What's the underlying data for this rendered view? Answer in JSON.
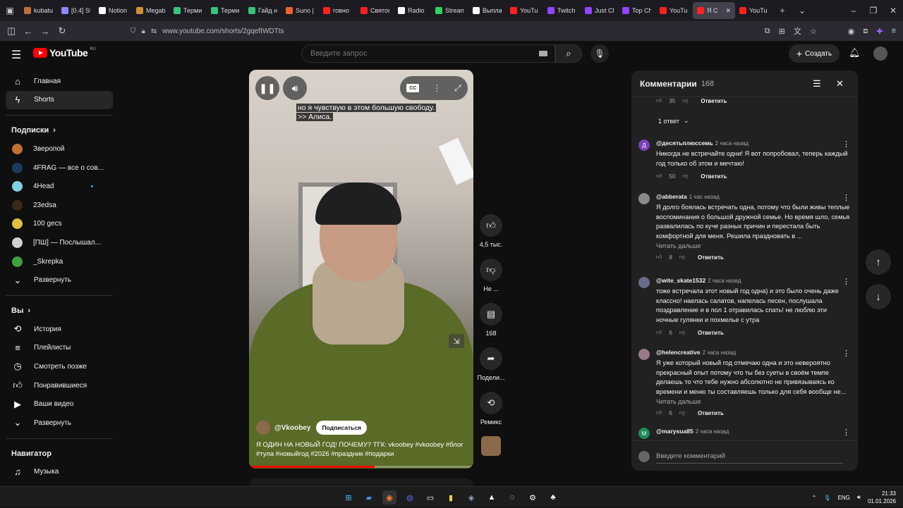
{
  "browser": {
    "tabs": [
      {
        "title": "kubatu",
        "color": "#c0703a"
      },
      {
        "title": "[0.4] St",
        "color": "#8888ff"
      },
      {
        "title": "Notion",
        "color": "#ffffff"
      },
      {
        "title": "Megab",
        "color": "#d09030"
      },
      {
        "title": "Терми",
        "color": "#3ac27a"
      },
      {
        "title": "Терми",
        "color": "#3ac27a"
      },
      {
        "title": "Гайд н",
        "color": "#3ac27a"
      },
      {
        "title": "Suno |",
        "color": "#f06030"
      },
      {
        "title": "говно",
        "color": "#ff2020"
      },
      {
        "title": "Святог",
        "color": "#ff2020"
      },
      {
        "title": "Radio",
        "color": "#ffffff"
      },
      {
        "title": "Stream",
        "color": "#30d060"
      },
      {
        "title": "Выпла",
        "color": "#ffffff"
      },
      {
        "title": "YouTu",
        "color": "#ff2020"
      },
      {
        "title": "Twitch",
        "color": "#9146ff"
      },
      {
        "title": "Just Ch",
        "color": "#9146ff"
      },
      {
        "title": "Top Ch",
        "color": "#9146ff"
      },
      {
        "title": "YouTu",
        "color": "#ff2020"
      },
      {
        "title": "Я С",
        "color": "#ff2020",
        "active": true
      },
      {
        "title": "YouTu",
        "color": "#ff2020"
      }
    ],
    "url": "www.youtube.com/shorts/2gqefIWDTts"
  },
  "header": {
    "logo_text": "YouTube",
    "logo_region": "RU",
    "search_placeholder": "Введите запрос",
    "create_label": "Создать"
  },
  "sidebar": {
    "main": [
      {
        "label": "Главная",
        "icon": "home-icon"
      },
      {
        "label": "Shorts",
        "icon": "shorts-icon",
        "active": true
      }
    ],
    "subs_heading": "Подписки",
    "subs": [
      {
        "label": "Зверопой",
        "color": "#c07030"
      },
      {
        "label": "4FRAG — все о сов...",
        "color": "#1a3a5a"
      },
      {
        "label": "4Head",
        "color": "#80d0e0",
        "new": true
      },
      {
        "label": "23edsa",
        "color": "#3a2a1a"
      },
      {
        "label": "100 gecs",
        "color": "#e0c040"
      },
      {
        "label": "[ПШ] — Послышал...",
        "color": "#d0d0d0"
      },
      {
        "label": "_Skrepka",
        "color": "#40a040"
      }
    ],
    "expand1": "Развернуть",
    "you_heading": "Вы",
    "you": [
      {
        "label": "История",
        "icon": "history-icon"
      },
      {
        "label": "Плейлисты",
        "icon": "playlists-icon"
      },
      {
        "label": "Смотреть позже",
        "icon": "watch-later-icon"
      },
      {
        "label": "Понравившиеся",
        "icon": "liked-icon"
      },
      {
        "label": "Ваши видео",
        "icon": "your-videos-icon"
      }
    ],
    "expand2": "Развернуть",
    "nav_heading": "Навигатор",
    "music": "Музыка"
  },
  "video": {
    "caption_line1": "но я чувствую в этом большую свободу.",
    "caption_line2": ">> Алиса.",
    "author": "@Vkoobey",
    "subscribe": "Подписаться",
    "title": "Я ОДИН НА НОВЫЙ ГОД! ПОЧЕМУ? ТГК: vkoobey #vkoobey #блог #тула #новыйгод #2026 #праздник #подарки",
    "progress": 0.56
  },
  "rail": {
    "likes": "4,5 тыс.",
    "dislike": "Не ...",
    "comments": "168",
    "share": "Подели...",
    "remix": "Ремикс"
  },
  "comments": {
    "title": "Комментарии",
    "count": "168",
    "top_likes": "35",
    "reply_label": "Ответить",
    "replies_toggle": "1 ответ",
    "items": [
      {
        "avatar": "Д",
        "color": "#7b3fb8",
        "user": "@десятьплюссемь",
        "time": "2 часа назад",
        "text": "Никогда не встречайте одни! Я вот попробовал, теперь каждый год только об этом и мечтаю!",
        "likes": "50"
      },
      {
        "avatar": "",
        "color": "#8a8a8a",
        "user": "@abberata",
        "time": "1 час назад",
        "text": "Я долго боялась встречать одна, потому что были живы теплые воспоминания о большой дружной семье. Но время шло, семья развалилась по куче разных причин и перестала быть комфортной для меня. Решила праздновать в ...",
        "more": "Читать дальше",
        "likes": "8"
      },
      {
        "avatar": "",
        "color": "#6a6a8a",
        "user": "@wite_skate1532",
        "time": "2 часа назад",
        "text": "тоже встречала этот новый год одна) и это было очень даже классно! наелась салатов, напелась песен, послушала поздравление и в пол 1 отравилась спать! не люблю эти ночные гулянки и похмелье с утра",
        "likes": "6"
      },
      {
        "avatar": "",
        "color": "#9a7a8a",
        "user": "@helencreative",
        "time": "2 часа назад",
        "text": "Я уже который новый год отмечаю одна и это невероятно прекрасный опыт потому что ты без суеты в своём темпе делаешь то что тебе нужно абсолютно не привязываясь ко времени и меню ты составляешь только для себя вообще не...",
        "more": "Читать дальше",
        "likes": "6"
      },
      {
        "avatar": "M",
        "color": "#1e8a5a",
        "user": "@marysua85",
        "time": "2 часа назад",
        "text": "",
        "likes": ""
      }
    ],
    "input_placeholder": "Введите комментарий"
  },
  "taskbar": {
    "lang": "ENG",
    "time": "21:33",
    "date": "01.01.2026"
  }
}
